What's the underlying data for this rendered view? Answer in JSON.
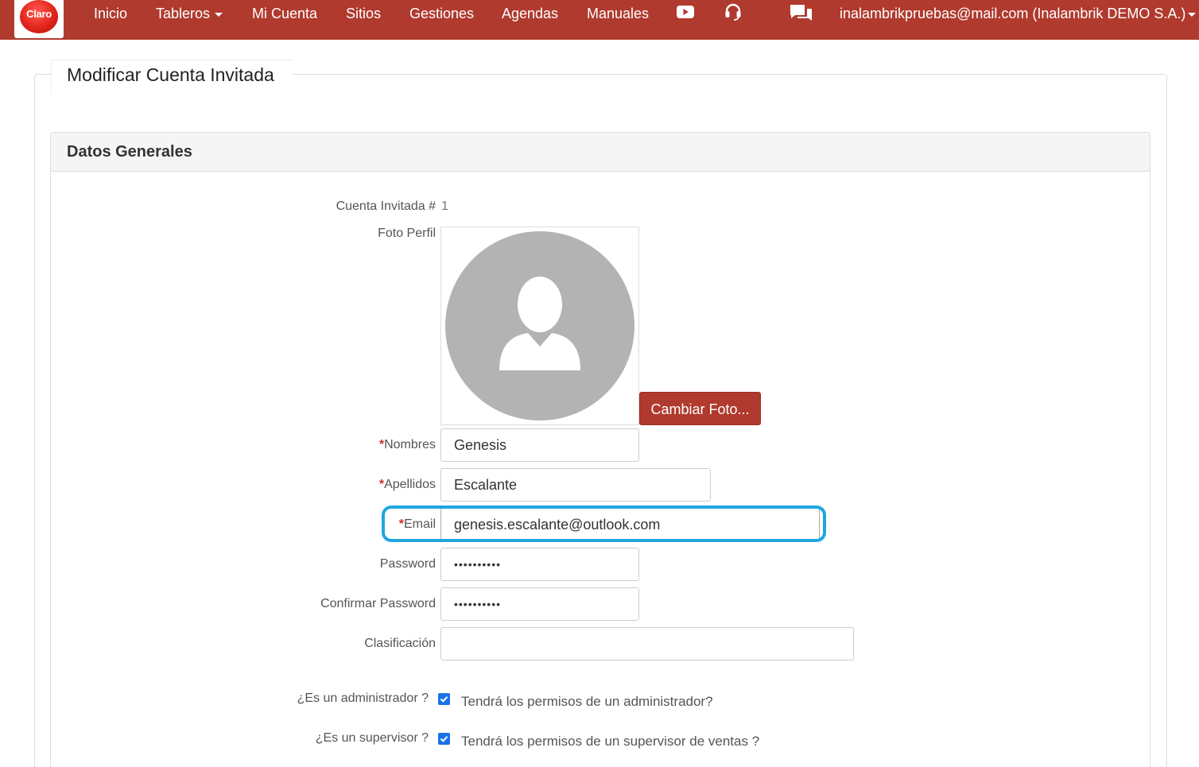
{
  "nav": {
    "logo_text": "Claro",
    "items": [
      "Inicio",
      "Tableros",
      "Mi Cuenta",
      "Sitios",
      "Gestiones",
      "Agendas",
      "Manuales"
    ],
    "user": "inalambrikpruebas@mail.com (Inalambrik DEMO S.A.)",
    "icons": [
      "youtube-icon",
      "headset-icon",
      "chat-icon"
    ]
  },
  "page": {
    "title": "Modificar Cuenta Invitada",
    "section_title": "Datos Generales"
  },
  "form": {
    "account_label": "Cuenta Invitada #",
    "account_value": "1",
    "photo_label": "Foto Perfil",
    "change_photo": "Cambiar Foto...",
    "required_mark": "*",
    "nombres_label": "Nombres",
    "nombres_value": "Genesis",
    "apellidos_label": "Apellidos",
    "apellidos_value": "Escalante",
    "email_label": "Email",
    "email_value": "genesis.escalante@outlook.com",
    "password_label": "Password",
    "password_value": "••••••••••",
    "confirm_label": "Confirmar Password",
    "confirm_value": "••••••••••",
    "clasificacion_label": "Clasificación",
    "clasificacion_value": "",
    "admin_label": "¿Es un administrador ?",
    "admin_desc": "Tendrá los permisos de un administrador?",
    "supervisor_label": "¿Es un supervisor ?",
    "supervisor_desc": "Tendrá los permisos de un supervisor de ventas ?"
  },
  "colors": {
    "navbar": "#b03a2e",
    "highlight": "#1fa6e0",
    "checkbox": "#1a73e8"
  }
}
